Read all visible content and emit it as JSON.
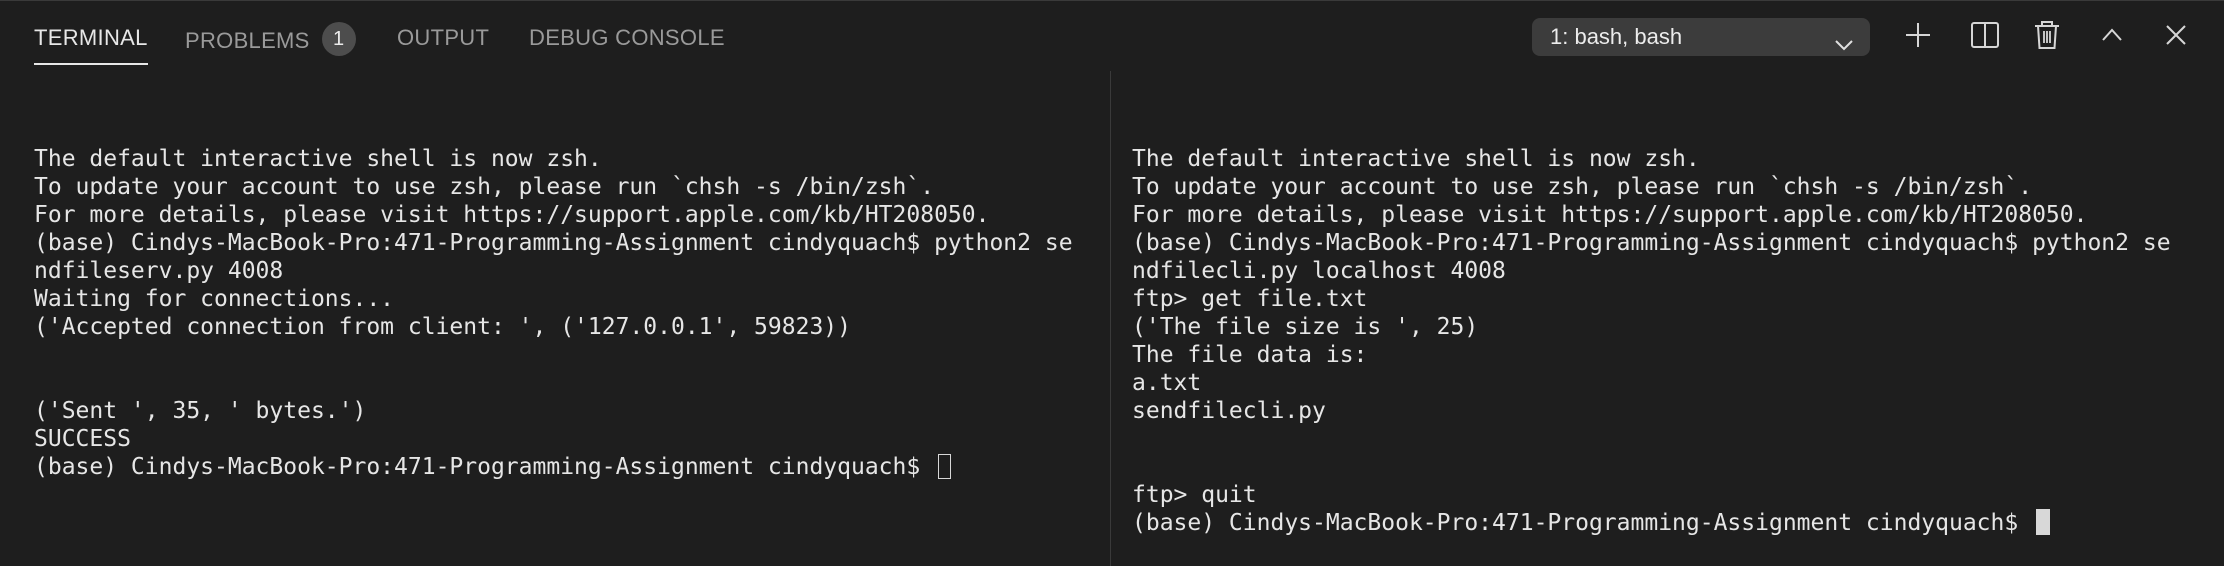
{
  "tabs": [
    {
      "label": "TERMINAL",
      "active": true
    },
    {
      "label": "PROBLEMS",
      "badge": "1",
      "active": false
    },
    {
      "label": "OUTPUT",
      "active": false
    },
    {
      "label": "DEBUG CONSOLE",
      "active": false
    }
  ],
  "terminal_select": {
    "value": "1: bash, bash"
  },
  "actions": [
    {
      "icon": "plus-icon"
    },
    {
      "icon": "split-icon"
    },
    {
      "icon": "trash-icon"
    },
    {
      "icon": "chevron-up-icon"
    },
    {
      "icon": "close-icon"
    }
  ],
  "left_pane": {
    "lines": [
      "",
      "The default interactive shell is now zsh.",
      "To update your account to use zsh, please run `chsh -s /bin/zsh`.",
      "For more details, please visit https://support.apple.com/kb/HT208050.",
      "(base) Cindys-MacBook-Pro:471-Programming-Assignment cindyquach$ python2 se",
      "ndfileserv.py 4008",
      "Waiting for connections...",
      "('Accepted connection from client: ', ('127.0.0.1', 59823))",
      "",
      "",
      "('Sent ', 35, ' bytes.')",
      "SUCCESS"
    ],
    "prompt": "(base) Cindys-MacBook-Pro:471-Programming-Assignment cindyquach$ "
  },
  "right_pane": {
    "lines": [
      "",
      "The default interactive shell is now zsh.",
      "To update your account to use zsh, please run `chsh -s /bin/zsh`.",
      "For more details, please visit https://support.apple.com/kb/HT208050.",
      "(base) Cindys-MacBook-Pro:471-Programming-Assignment cindyquach$ python2 se",
      "ndfilecli.py localhost 4008",
      "ftp> get file.txt",
      "('The file size is ', 25)",
      "The file data is:",
      "a.txt",
      "sendfilecli.py",
      "",
      "",
      "ftp> quit"
    ],
    "prompt": "(base) Cindys-MacBook-Pro:471-Programming-Assignment cindyquach$ "
  },
  "colors": {
    "background": "#1e1e1e",
    "text": "#e6e6e6",
    "tab_inactive": "#9a9a9a",
    "dropdown_bg": "#3c3c3c"
  }
}
